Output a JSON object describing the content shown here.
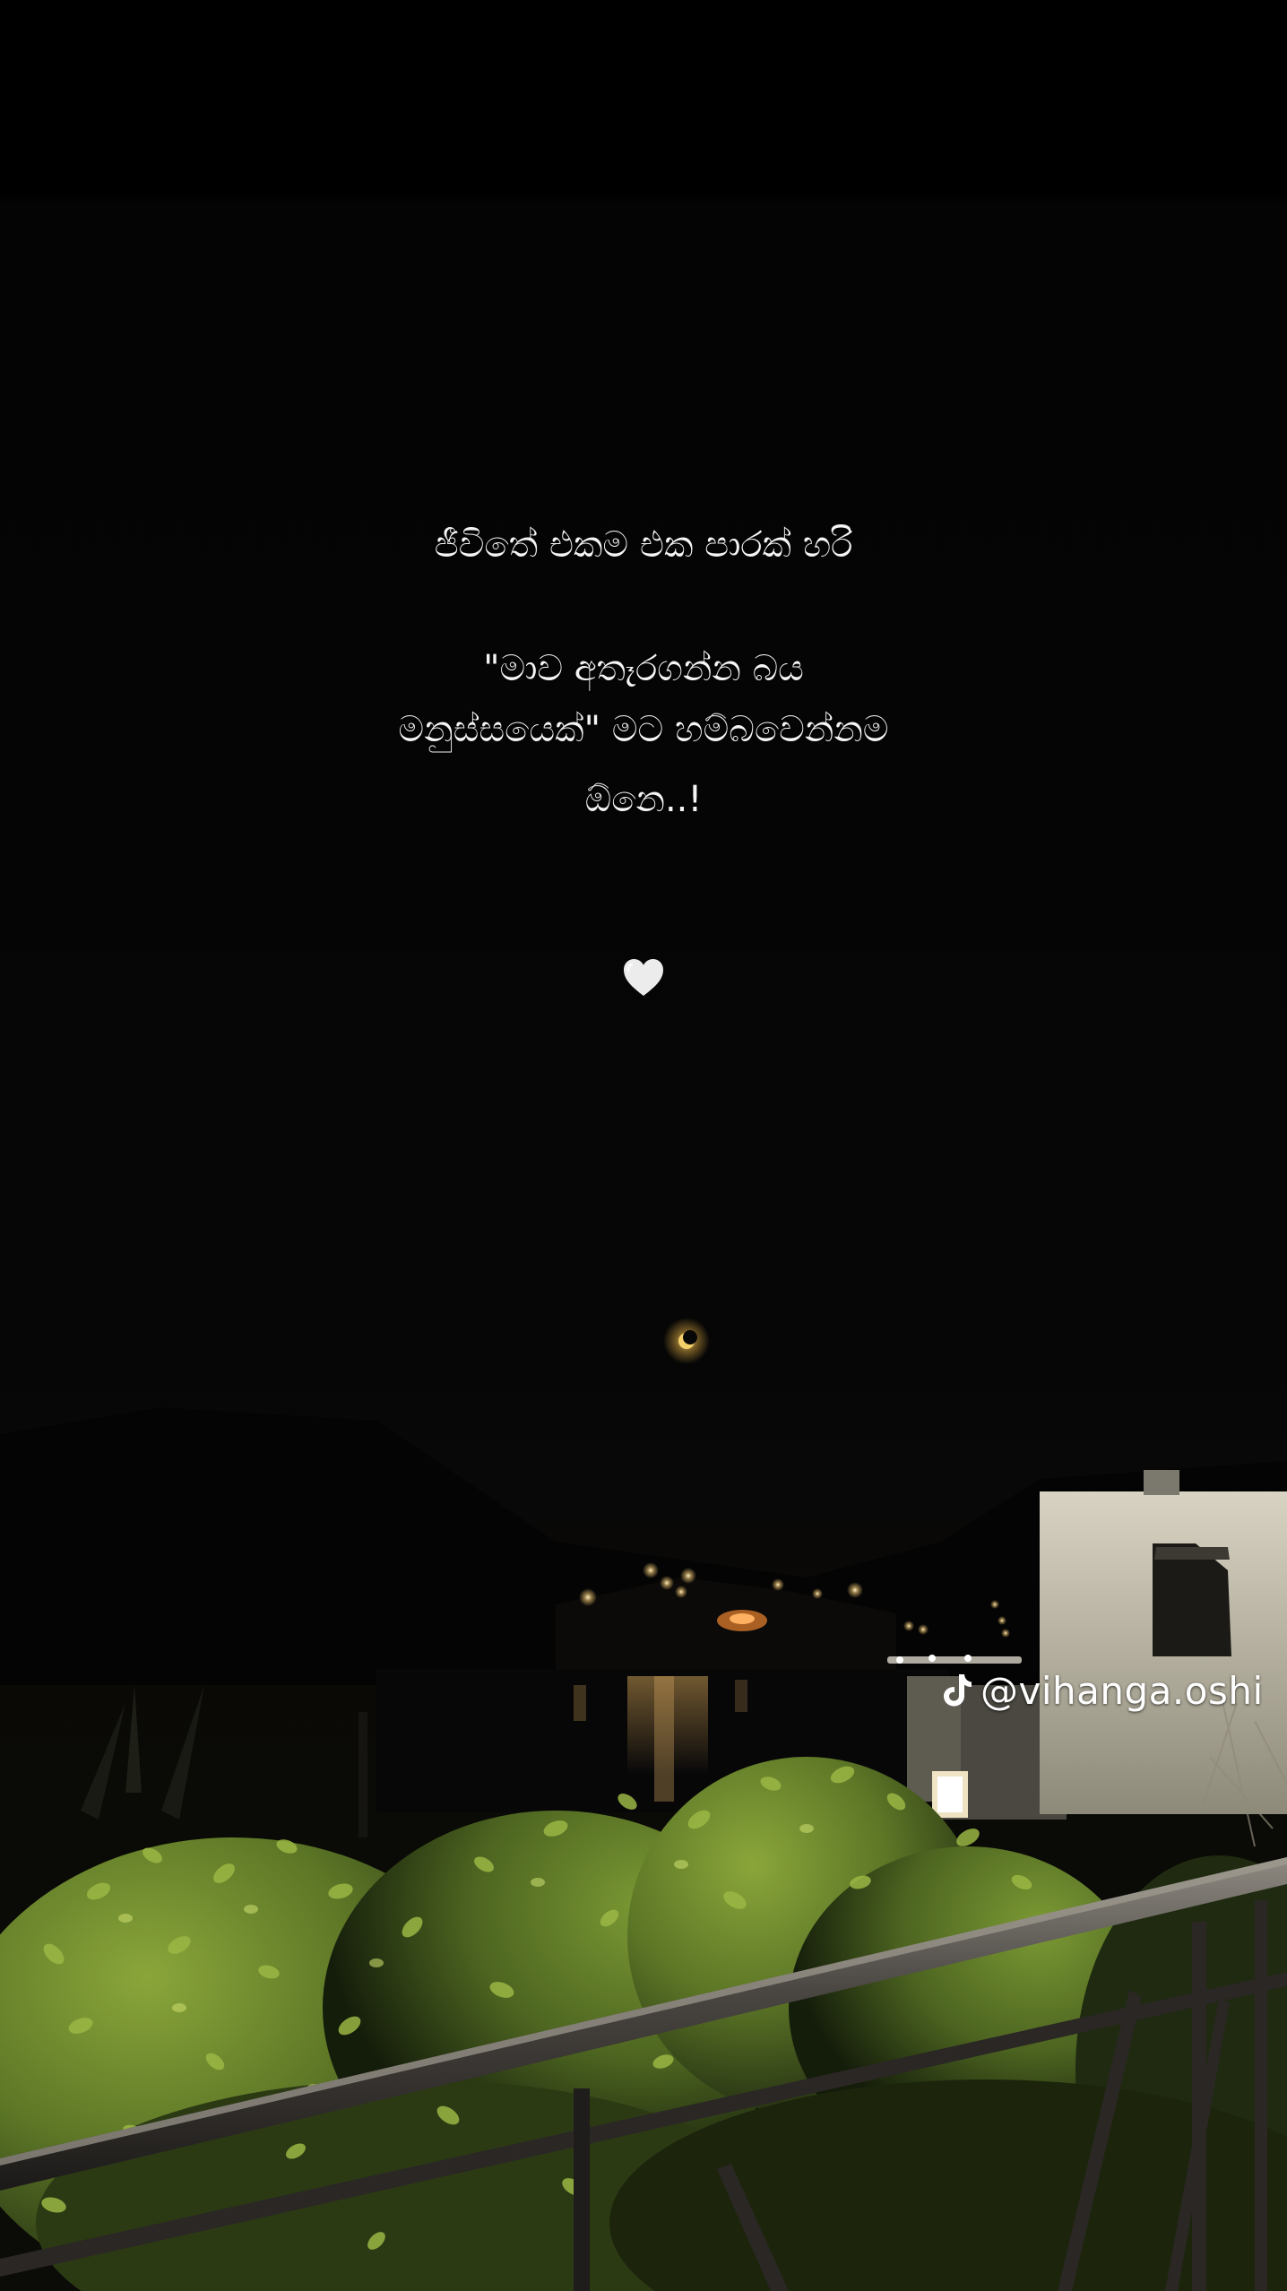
{
  "quote": {
    "line1": "ජීවිතේ එකම එක පාරක් හරි",
    "line2": "\"මාව අතෑරගන්න බය",
    "line3": "මනුස්සයෙක්\" මට හම්බවෙන්නම",
    "line4": "ඕනෙ..!"
  },
  "heart_icon": "white-heart-icon",
  "watermark": {
    "icon": "tiktok-icon",
    "handle": "@vihanga.oshi"
  },
  "colors": {
    "text": "#f5f5f5",
    "background": "#000000",
    "foliage": "#6f8a2c"
  }
}
